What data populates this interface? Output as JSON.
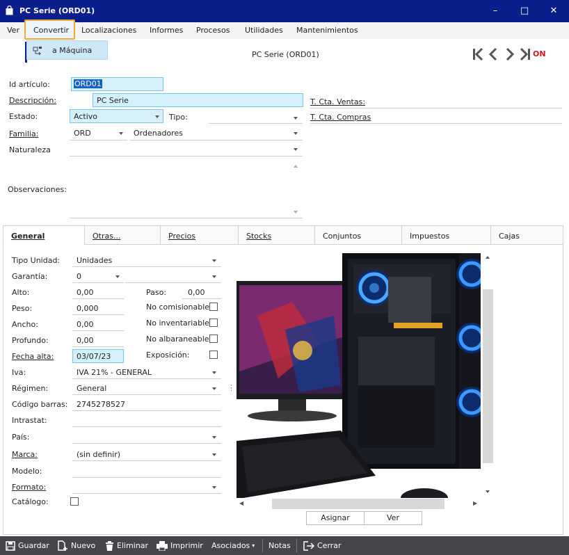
{
  "window": {
    "title": "PC Serie (ORD01)",
    "minimize": "–",
    "maximize": "□",
    "close": "✕"
  },
  "menu": {
    "items": [
      "Ver",
      "Convertir",
      "Localizaciones",
      "Informes",
      "Procesos",
      "Utilidades",
      "Mantenimientos"
    ],
    "open_dropdown": {
      "label": "a Máquina"
    }
  },
  "header": {
    "doc_title": "PC Serie (ORD01)",
    "on_label": "ON"
  },
  "form": {
    "id_articulo": {
      "label": "Id artículo:",
      "value": "ORD01"
    },
    "descripcion": {
      "label": "Descripción:",
      "value": "PC Serie"
    },
    "estado": {
      "label": "Estado:",
      "value": "Activo"
    },
    "tipo": {
      "label": "Tipo:",
      "value": ""
    },
    "familia": {
      "label": "Familia:",
      "code": "ORD",
      "name": "Ordenadores"
    },
    "naturaleza": {
      "label": "Naturaleza",
      "value": ""
    },
    "observaciones": {
      "label": "Observaciones:",
      "value": ""
    },
    "cta_ventas": {
      "label": "T. Cta. Ventas:",
      "value": ""
    },
    "cta_compras": {
      "label": "T. Cta. Compras",
      "value": ""
    }
  },
  "tabs": [
    {
      "label": "General",
      "active": true
    },
    {
      "label": "Otras..."
    },
    {
      "label": "Precios"
    },
    {
      "label": "Stocks"
    },
    {
      "label": "Conjuntos"
    },
    {
      "label": "Impuestos"
    },
    {
      "label": "Cajas"
    }
  ],
  "general": {
    "tipo_unidad": {
      "label": "Tipo Unidad:",
      "value": "Unidades"
    },
    "garantia": {
      "label": "Garantía:",
      "value": "0"
    },
    "alto": {
      "label": "Alto:",
      "value": "0,00"
    },
    "paso": {
      "label": "Paso:",
      "value": "0,00"
    },
    "peso": {
      "label": "Peso:",
      "value": "0,000"
    },
    "ancho": {
      "label": "Ancho:",
      "value": "0,00"
    },
    "profundo": {
      "label": "Profundo:",
      "value": "0,00"
    },
    "fecha_alta": {
      "label": "Fecha alta:",
      "value": "03/07/23"
    },
    "iva": {
      "label": "Iva:",
      "value": "IVA 21% - GENERAL"
    },
    "regimen": {
      "label": "Régimen:",
      "value": "General"
    },
    "codigo_barras": {
      "label": "Código barras:",
      "value": "2745278527"
    },
    "intrastat": {
      "label": "Intrastat:",
      "value": ""
    },
    "pais": {
      "label": "País:",
      "value": ""
    },
    "marca": {
      "label": "Marca:",
      "value": "(sin definir)"
    },
    "modelo": {
      "label": "Modelo:",
      "value": ""
    },
    "formato": {
      "label": "Formato:",
      "value": ""
    },
    "catalogo": {
      "label": "Catálogo:",
      "checked": false
    },
    "no_comisionable": {
      "label": "No comisionable",
      "checked": false
    },
    "no_inventariable": {
      "label": "No inventariable",
      "checked": false
    },
    "no_albaraneable": {
      "label": "No albaraneable:",
      "checked": false
    },
    "exposicion": {
      "label": "Exposición:",
      "checked": false
    }
  },
  "image_buttons": {
    "assign": "Asignar",
    "view": "Ver"
  },
  "bottom_bar": {
    "save": "Guardar",
    "new": "Nuevo",
    "delete": "Eliminar",
    "print": "Imprimir",
    "associated": "Asociados",
    "notes": "Notas",
    "close": "Cerrar"
  },
  "colors": {
    "titlebar": "#0a1e8c",
    "field_highlight": "#d6f0fa",
    "selection": "#1463c6",
    "on": "#cc1a1a",
    "bottom_bar": "#45464c",
    "menu_focus": "#f0a830"
  }
}
